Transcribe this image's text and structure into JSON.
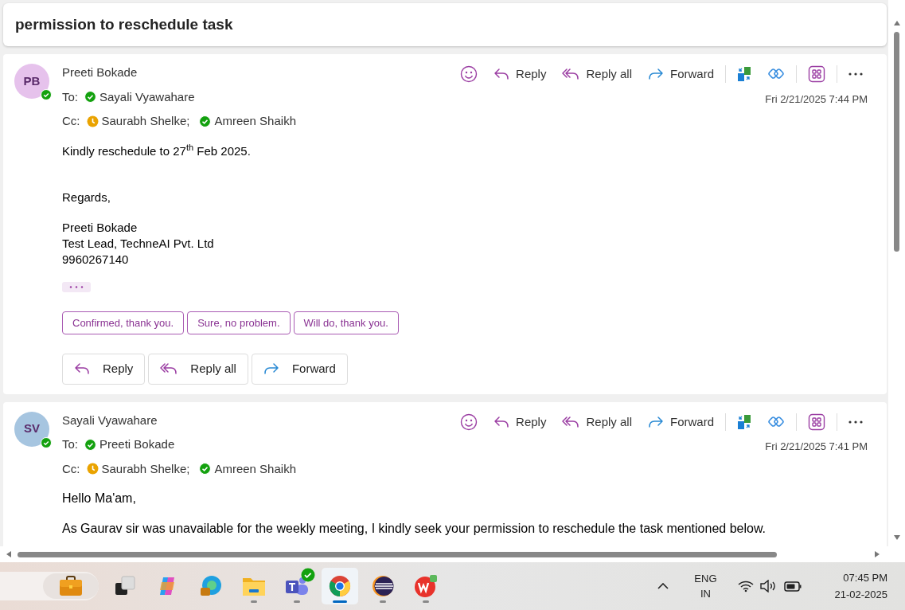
{
  "subject": "permission to reschedule task",
  "messages": [
    {
      "sender": "Preeti Bokade",
      "initials": "PB",
      "color": "#e6c2ec",
      "away": false,
      "toolbar": [
        {
          "kind": "emoji"
        },
        {
          "kind": "reply",
          "label": "Reply"
        },
        {
          "kind": "reply_all",
          "label": "Reply all"
        },
        {
          "kind": "forward",
          "label": "Forward"
        },
        {
          "kind": "translate"
        },
        {
          "kind": "loop"
        },
        {
          "kind": "apps"
        },
        {
          "kind": "more"
        }
      ],
      "to_label": "To:",
      "to": [
        {
          "name": "Sayali Vyawahare",
          "away": false
        }
      ],
      "cc_label": "Cc:",
      "cc": [
        {
          "name": "Saurabh Shelke;",
          "away": true
        },
        {
          "name": "Amreen Shaikh",
          "away": false
        }
      ],
      "time": "Fri 2/21/2025 7:44 PM",
      "body": [
        [
          "Kindly reschedule to 27$^{th}$ Feb 2025."
        ],
        [
          "Regards,"
        ],
        [
          "Preeti Bokade",
          "Test Lead, TechneAI Pvt. Ltd",
          "9960267140"
        ]
      ],
      "trimmed": true,
      "suggested_replies": [
        "Confirmed, thank you.",
        "Sure, no problem.",
        "Will do, thank you."
      ],
      "reply_buttons": [
        {
          "kind": "reply",
          "label": "Reply"
        },
        {
          "kind": "reply_all",
          "label": "Reply all"
        },
        {
          "kind": "forward",
          "label": "Forward"
        }
      ]
    },
    {
      "sender": "Sayali Vyawahare",
      "initials": "SV",
      "color": "#a6c5e0",
      "away": false,
      "toolbar": [
        {
          "kind": "emoji"
        },
        {
          "kind": "reply",
          "label": "Reply"
        },
        {
          "kind": "reply_all",
          "label": "Reply all"
        },
        {
          "kind": "forward",
          "label": "Forward"
        },
        {
          "kind": "translate"
        },
        {
          "kind": "loop"
        },
        {
          "kind": "apps"
        },
        {
          "kind": "more"
        }
      ],
      "to_label": "To:",
      "to": [
        {
          "name": "Preeti Bokade",
          "away": false
        }
      ],
      "cc_label": "Cc:",
      "cc": [
        {
          "name": "Saurabh Shelke;",
          "away": true
        },
        {
          "name": "Amreen Shaikh",
          "away": false
        }
      ],
      "time": "Fri 2/21/2025 7:41 PM",
      "body": [
        [
          "Hello Ma'am,"
        ],
        [
          "As Gaurav sir was unavailable for the weekly meeting, I kindly seek your permission to reschedule the task mentioned below."
        ]
      ],
      "trimmed": false
    }
  ],
  "taskbar": {
    "apps": [
      {
        "kind": "task_view",
        "selected": false,
        "running": false
      },
      {
        "kind": "copilot",
        "selected": false,
        "running": false
      },
      {
        "kind": "edge",
        "selected": false,
        "running": false
      },
      {
        "kind": "files",
        "selected": false,
        "running": true
      },
      {
        "kind": "teams",
        "selected": false,
        "running": true
      },
      {
        "kind": "chrome",
        "selected": true,
        "running": true
      },
      {
        "kind": "eclipse",
        "selected": false,
        "running": true
      },
      {
        "kind": "wps",
        "selected": false,
        "running": true
      }
    ],
    "language": "ENG",
    "region": "IN",
    "time": "07:45 PM",
    "date": "21-02-2025"
  }
}
